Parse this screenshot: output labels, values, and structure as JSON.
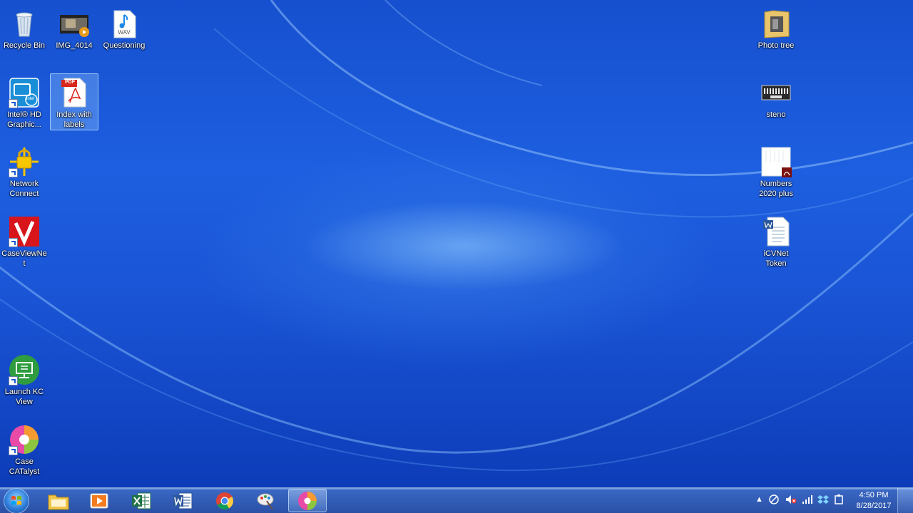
{
  "desktop": {
    "icons_left": [
      {
        "label": "Recycle Bin",
        "icon": "recycle-bin-icon"
      },
      {
        "label": "IMG_4014",
        "icon": "video-file-icon"
      },
      {
        "label": "Questioning",
        "icon": "wav-file-icon"
      },
      {
        "label": "Intel® HD Graphic...",
        "icon": "intel-graphics-icon"
      },
      {
        "label": "Index with labels",
        "icon": "pdf-file-icon"
      },
      {
        "label": "Network Connect",
        "icon": "network-connect-lock-icon"
      },
      {
        "label": "CaseViewNet",
        "icon": "caseviewnet-icon"
      },
      {
        "label": "Launch KC View",
        "icon": "kc-view-icon"
      },
      {
        "label": "Case CATalyst",
        "icon": "case-catalyst-icon"
      }
    ],
    "icons_right": [
      {
        "label": "Photo tree",
        "icon": "folder-icon"
      },
      {
        "label": "steno",
        "icon": "steno-machine-icon"
      },
      {
        "label": "Numbers 2020 plus",
        "icon": "pdf-document-icon"
      },
      {
        "label": "iCVNet Token",
        "icon": "word-document-icon"
      }
    ],
    "pdf_badge": "PDF",
    "wav_badge": "WAV",
    "intel_badge": "intel"
  },
  "taskbar": {
    "pinned": [
      {
        "name": "start-button",
        "icon": "windows-start-orb-icon"
      },
      {
        "name": "file-explorer",
        "icon": "file-explorer-icon"
      },
      {
        "name": "media-player",
        "icon": "media-player-icon"
      },
      {
        "name": "excel",
        "icon": "excel-icon"
      },
      {
        "name": "word",
        "icon": "word-icon"
      },
      {
        "name": "chrome",
        "icon": "chrome-icon"
      },
      {
        "name": "paint-tool",
        "icon": "paint-icon"
      },
      {
        "name": "case-catalyst",
        "icon": "case-catalyst-icon",
        "active": true
      }
    ],
    "tray_icons": [
      "show-hidden-icons-arrow",
      "network-sync-icon",
      "volume-muted-icon",
      "signal-bars-icon",
      "dropbox-icon",
      "power-icon"
    ],
    "time": "4:50 PM",
    "date": "8/28/2017"
  },
  "colors": {
    "desktop_blue": "#1a55d6",
    "excel_green": "#1e7145",
    "word_blue": "#2b579a",
    "pdf_red": "#d9261c"
  }
}
